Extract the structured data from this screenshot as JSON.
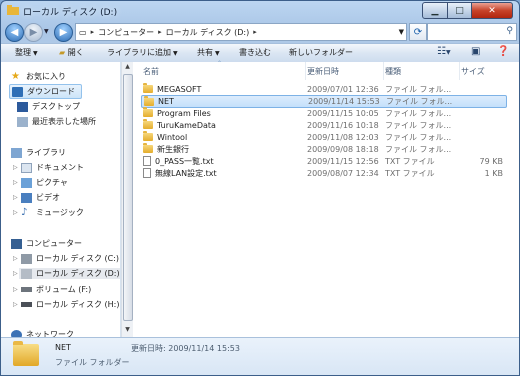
{
  "window": {
    "title": "ローカル ディスク (D:)"
  },
  "address": {
    "segments": [
      "コンピューター",
      "ローカル ディスク (D:)"
    ]
  },
  "toolbar": {
    "organize": "整理",
    "open": "開く",
    "add_to_library": "ライブラリに追加",
    "share": "共有",
    "burn": "書き込む",
    "new_folder": "新しいフォルダー"
  },
  "nav": {
    "favorites": {
      "header": "お気に入り",
      "items": [
        "ダウンロード",
        "デスクトップ",
        "最近表示した場所"
      ]
    },
    "libraries": {
      "header": "ライブラリ",
      "items": [
        "ドキュメント",
        "ピクチャ",
        "ビデオ",
        "ミュージック"
      ]
    },
    "computer": {
      "header": "コンピューター",
      "items": [
        "ローカル ディスク (C:)",
        "ローカル ディスク (D:)",
        "ボリューム (F:)",
        "ローカル ディスク (H:)"
      ]
    },
    "network": {
      "header": "ネットワーク"
    }
  },
  "columns": {
    "name": "名前",
    "date": "更新日時",
    "type": "種類",
    "size": "サイズ"
  },
  "files": [
    {
      "name": "MEGASOFT",
      "date": "2009/07/01 12:36",
      "type": "ファイル フォル...",
      "size": "",
      "kind": "folder"
    },
    {
      "name": "NET",
      "date": "2009/11/14 15:53",
      "type": "ファイル フォル...",
      "size": "",
      "kind": "folder"
    },
    {
      "name": "Program Files",
      "date": "2009/11/15 10:05",
      "type": "ファイル フォル...",
      "size": "",
      "kind": "folder"
    },
    {
      "name": "TuruKameData",
      "date": "2009/11/16 10:18",
      "type": "ファイル フォル...",
      "size": "",
      "kind": "folder"
    },
    {
      "name": "Wintool",
      "date": "2009/11/08 12:03",
      "type": "ファイル フォル...",
      "size": "",
      "kind": "folder"
    },
    {
      "name": "新生銀行",
      "date": "2009/09/08 18:18",
      "type": "ファイル フォル...",
      "size": "",
      "kind": "folder"
    },
    {
      "name": "0_PASS一覧.txt",
      "date": "2009/11/15 12:56",
      "type": "TXT ファイル",
      "size": "79 KB",
      "kind": "txt"
    },
    {
      "name": "無線LAN設定.txt",
      "date": "2009/08/07 12:34",
      "type": "TXT ファイル",
      "size": "1 KB",
      "kind": "txt"
    }
  ],
  "details": {
    "name": "NET",
    "modified": "更新日時: 2009/11/14 15:53",
    "type": "ファイル フォルダー"
  }
}
